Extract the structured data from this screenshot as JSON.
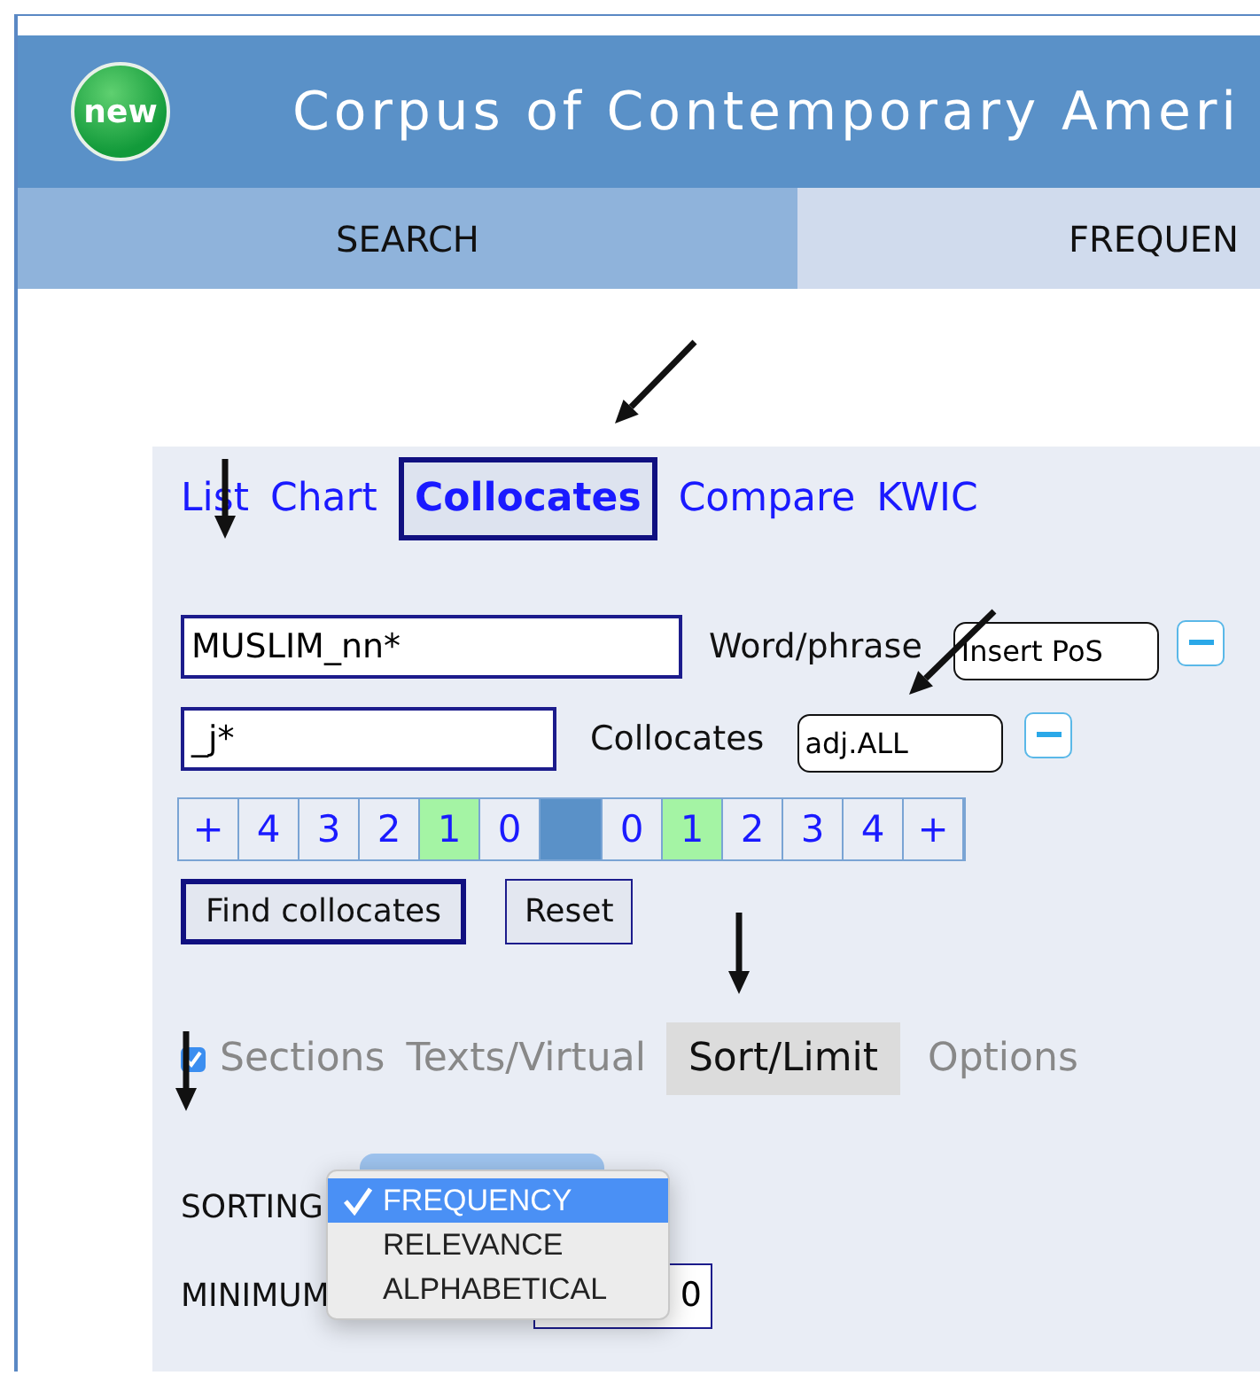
{
  "header": {
    "badge": "new",
    "title": "Corpus of Contemporary Ameri"
  },
  "main_tabs": [
    {
      "label": "SEARCH",
      "selected": true
    },
    {
      "label": "FREQUEN",
      "selected": false
    }
  ],
  "display_tabs": [
    {
      "label": "List",
      "selected": false
    },
    {
      "label": "Chart",
      "selected": false
    },
    {
      "label": "Collocates",
      "selected": true
    },
    {
      "label": "Compare",
      "selected": false
    },
    {
      "label": "KWIC",
      "selected": false
    }
  ],
  "word_row": {
    "value": "MUSLIM_nn*",
    "label": "Word/phrase",
    "pos": "Insert PoS"
  },
  "collocates_row": {
    "value": "_j*",
    "label": "Collocates",
    "pos": "adj.ALL"
  },
  "span": {
    "left": [
      {
        "label": "+",
        "selected": false
      },
      {
        "label": "4",
        "selected": false
      },
      {
        "label": "3",
        "selected": false
      },
      {
        "label": "2",
        "selected": false
      },
      {
        "label": "1",
        "selected": true
      },
      {
        "label": "0",
        "selected": false
      }
    ],
    "right": [
      {
        "label": "0",
        "selected": false
      },
      {
        "label": "1",
        "selected": true
      },
      {
        "label": "2",
        "selected": false
      },
      {
        "label": "3",
        "selected": false
      },
      {
        "label": "4",
        "selected": false
      },
      {
        "label": "+",
        "selected": false
      }
    ]
  },
  "buttons": [
    {
      "label": "Find collocates",
      "kind": "primary"
    },
    {
      "label": "Reset",
      "kind": "plain"
    }
  ],
  "sections_checkbox": {
    "checked": true
  },
  "option_tabs": [
    {
      "label": "Sections",
      "selected": false
    },
    {
      "label": "Texts/Virtual",
      "selected": false
    },
    {
      "label": "Sort/Limit",
      "selected": true
    },
    {
      "label": "Options",
      "selected": false
    }
  ],
  "sorting": {
    "label": "SORTING",
    "menu": [
      {
        "label": "FREQUENCY",
        "selected": true
      },
      {
        "label": "RELEVANCE",
        "selected": false
      },
      {
        "label": "ALPHABETICAL",
        "selected": false
      }
    ]
  },
  "minimum": {
    "label": "MINIMUM",
    "value": "0"
  }
}
